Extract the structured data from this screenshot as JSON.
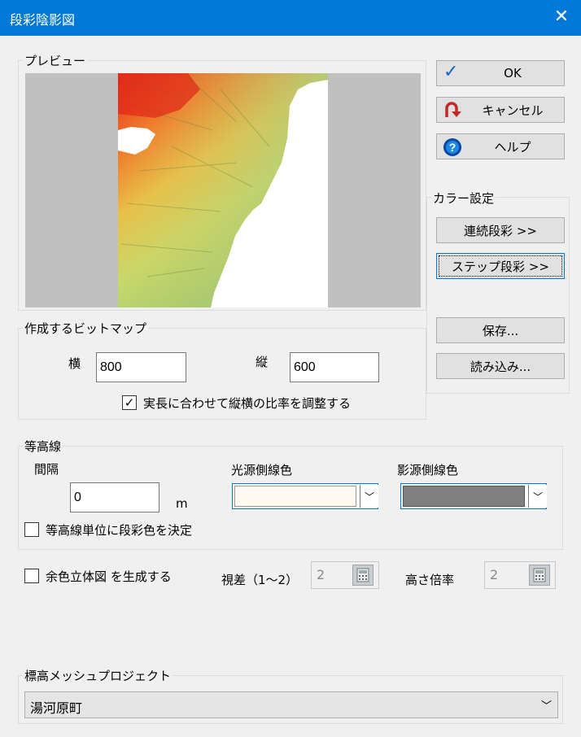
{
  "window": {
    "title": "段彩陰影図",
    "close_glyph": "✕"
  },
  "preview": {
    "label": "プレビュー"
  },
  "buttons": {
    "ok": "OK",
    "cancel": "キャンセル",
    "help": "ヘルプ",
    "continuous": "連続段彩 >>",
    "step": "ステップ段彩 >>",
    "save": "保存...",
    "load": "読み込み..."
  },
  "color_settings": {
    "label": "カラー設定"
  },
  "bitmap": {
    "label": "作成するビットマップ",
    "width_label": "横",
    "width_value": "800",
    "height_label": "縦",
    "height_value": "600",
    "keep_ratio_label": "実長に合わせて縦横の比率を調整する",
    "keep_ratio_checked": true
  },
  "contour": {
    "label": "等高線",
    "interval_label": "間隔",
    "interval_value": "0",
    "interval_unit": "m",
    "light_label": "光源側線色",
    "light_color": "#fffaf0",
    "shadow_label": "影源側線色",
    "shadow_color": "#808080",
    "unit_color_label": "等高線単位に段彩色を決定",
    "unit_color_checked": false
  },
  "stereo": {
    "label": "余色立体図 を生成する",
    "checked": false,
    "parallax_label": "視差（1〜2）",
    "parallax_value": "2",
    "height_scale_label": "高さ倍率",
    "height_scale_value": "2"
  },
  "project": {
    "label": "標高メッシュプロジェクト",
    "selected": "湯河原町"
  },
  "colors": {
    "titlebar": "#0078d7",
    "ok_check": "#1565c0",
    "cancel_arrow": "#c62828",
    "help_icon": "#0d47a1"
  }
}
